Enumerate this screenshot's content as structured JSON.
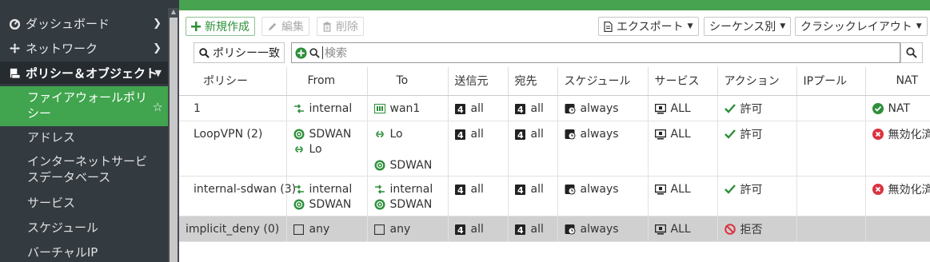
{
  "sidebar": {
    "items": [
      {
        "label": "ダッシュボード",
        "icon": "dashboard-icon"
      },
      {
        "label": "ネットワーク",
        "icon": "network-icon"
      },
      {
        "label": "ポリシー＆オブジェクト",
        "icon": "policy-icon"
      }
    ],
    "subitems": [
      {
        "label": "ファイアウォールポリシー"
      },
      {
        "label": "アドレス"
      },
      {
        "label": "インターネットサービスデータベース"
      },
      {
        "label": "サービス"
      },
      {
        "label": "スケジュール"
      },
      {
        "label": "バーチャルIP"
      }
    ]
  },
  "toolbar": {
    "new_label": "新規作成",
    "edit_label": "編集",
    "delete_label": "削除",
    "export_label": "エクスポート",
    "sequence_label": "シーケンス別",
    "layout_label": "クラシックレイアウト"
  },
  "search": {
    "filter_label": "ポリシー一致",
    "placeholder": "検索"
  },
  "table": {
    "headers": [
      "ポリシー",
      "From",
      "To",
      "送信元",
      "宛先",
      "スケジュール",
      "サービス",
      "アクション",
      "IPプール",
      "NAT"
    ],
    "rows": [
      {
        "policy": "1",
        "from": [
          {
            "icon": "interface-pair-icon",
            "text": "internal"
          }
        ],
        "to": [
          {
            "icon": "wan-port-icon",
            "text": "wan1"
          }
        ],
        "src": "all",
        "dst": "all",
        "schedule": "always",
        "service": "ALL",
        "action": "許可",
        "ippool": "",
        "nat": "NAT"
      },
      {
        "policy": "LoopVPN (2)",
        "from": [
          {
            "icon": "sdwan-icon",
            "text": "SDWAN"
          },
          {
            "icon": "loopback-icon",
            "text": "Lo"
          }
        ],
        "to": [
          {
            "icon": "loopback-icon",
            "text": "Lo"
          },
          {
            "icon": "sdwan-icon",
            "text": "SDWAN"
          }
        ],
        "src": "all",
        "dst": "all",
        "schedule": "always",
        "service": "ALL",
        "action": "許可",
        "ippool": "",
        "nat": "無効化済"
      },
      {
        "policy": "internal-sdwan (3)",
        "from": [
          {
            "icon": "interface-pair-icon",
            "text": "internal"
          },
          {
            "icon": "sdwan-icon",
            "text": "SDWAN"
          }
        ],
        "to": [
          {
            "icon": "interface-pair-icon",
            "text": "internal"
          },
          {
            "icon": "sdwan-icon",
            "text": "SDWAN"
          }
        ],
        "src": "all",
        "dst": "all",
        "schedule": "always",
        "service": "ALL",
        "action": "許可",
        "ippool": "",
        "nat": "無効化済"
      },
      {
        "policy": "implicit_deny (0)",
        "from": [
          {
            "icon": "checkbox-icon",
            "text": "any"
          }
        ],
        "to": [
          {
            "icon": "checkbox-icon",
            "text": "any"
          }
        ],
        "src": "all",
        "dst": "all",
        "schedule": "always",
        "service": "ALL",
        "action": "拒否",
        "ippool": "",
        "nat": ""
      }
    ]
  },
  "colors": {
    "accent_green": "#48a351",
    "sidebar_bg": "#333a40",
    "deny_red": "#d9333f",
    "allow_green": "#2d8f3a"
  }
}
